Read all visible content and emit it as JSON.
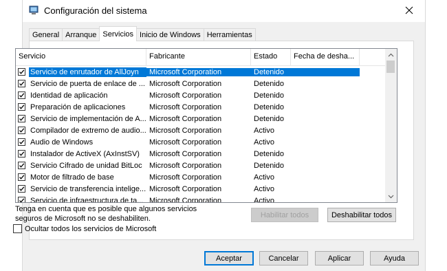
{
  "window": {
    "title": "Configuración del sistema"
  },
  "tabs": [
    {
      "label": "General",
      "active": false
    },
    {
      "label": "Arranque",
      "active": false
    },
    {
      "label": "Servicios",
      "active": true
    },
    {
      "label": "Inicio de Windows",
      "active": false
    },
    {
      "label": "Herramientas",
      "active": false
    }
  ],
  "columns": {
    "service": "Servicio",
    "maker": "Fabricante",
    "status": "Estado",
    "disabled_date": "Fecha de desha..."
  },
  "rows": [
    {
      "name": "Servicio de enrutador de AllJoyn",
      "maker": "Microsoft Corporation",
      "status": "Detenido",
      "checked": true,
      "selected": true
    },
    {
      "name": "Servicio de puerta de enlace de ...",
      "maker": "Microsoft Corporation",
      "status": "Detenido",
      "checked": true,
      "selected": false
    },
    {
      "name": "Identidad de aplicación",
      "maker": "Microsoft Corporation",
      "status": "Detenido",
      "checked": true,
      "selected": false
    },
    {
      "name": "Preparación de aplicaciones",
      "maker": "Microsoft Corporation",
      "status": "Detenido",
      "checked": true,
      "selected": false
    },
    {
      "name": "Servicio de implementación de A...",
      "maker": "Microsoft Corporation",
      "status": "Detenido",
      "checked": true,
      "selected": false
    },
    {
      "name": "Compilador de extremo de audio...",
      "maker": "Microsoft Corporation",
      "status": "Activo",
      "checked": true,
      "selected": false
    },
    {
      "name": "Audio de Windows",
      "maker": "Microsoft Corporation",
      "status": "Activo",
      "checked": true,
      "selected": false
    },
    {
      "name": "Instalador de ActiveX (AxInstSV)",
      "maker": "Microsoft Corporation",
      "status": "Detenido",
      "checked": true,
      "selected": false
    },
    {
      "name": "Servicio Cifrado de unidad BitLoc",
      "maker": "Microsoft Corporation",
      "status": "Detenido",
      "checked": true,
      "selected": false
    },
    {
      "name": "Motor de filtrado de base",
      "maker": "Microsoft Corporation",
      "status": "Activo",
      "checked": true,
      "selected": false
    },
    {
      "name": "Servicio de transferencia intelige...",
      "maker": "Microsoft Corporation",
      "status": "Activo",
      "checked": true,
      "selected": false
    },
    {
      "name": "Servicio de infraestructura de ta...",
      "maker": "Microsoft Corporation",
      "status": "Activo",
      "checked": true,
      "selected": false
    }
  ],
  "note": "Tenga en cuenta que es posible que algunos servicios seguros de Microsoft no se deshabiliten.",
  "buttons": {
    "enable_all": "Habilitar todos",
    "disable_all": "Deshabilitar todos",
    "ok": "Aceptar",
    "cancel": "Cancelar",
    "apply": "Aplicar",
    "help": "Ayuda"
  },
  "hide_ms": {
    "label": "Ocultar todos los servicios de Microsoft",
    "checked": false
  },
  "colors": {
    "selection": "#0078d7",
    "accent_border": "#0078d7"
  }
}
